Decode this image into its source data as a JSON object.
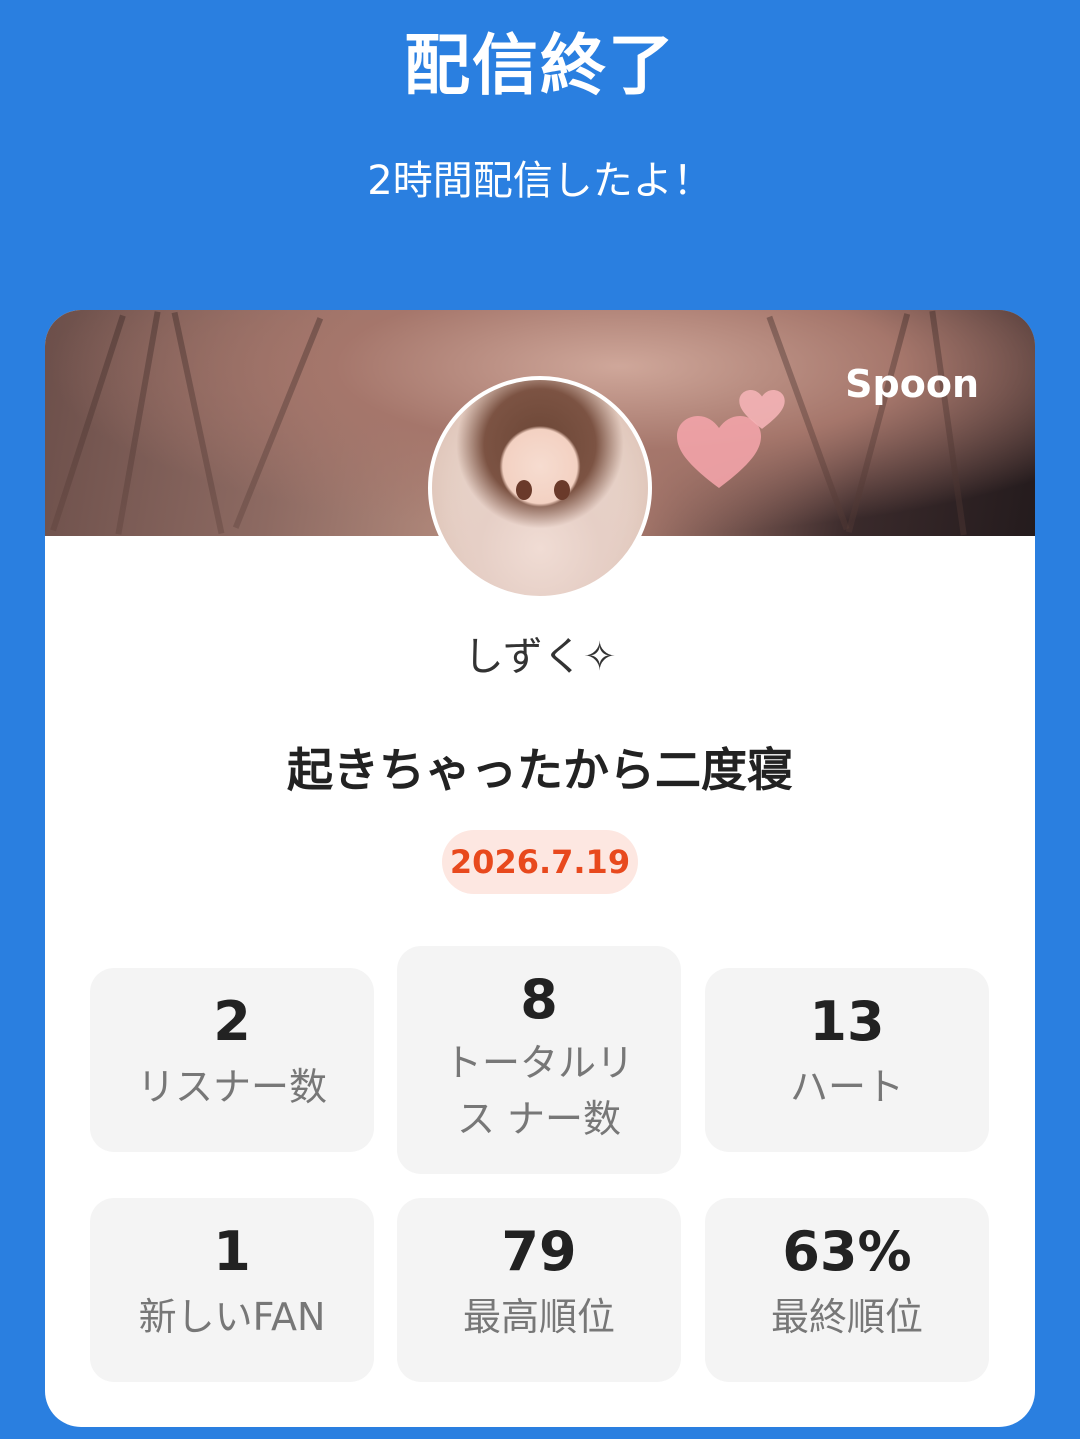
{
  "header": {
    "title": "配信終了",
    "subtitle": "2時間配信したよ！"
  },
  "card": {
    "logo": "Spoon",
    "username": "しずく✧",
    "broadcast_title": "起きちゃったから二度寝",
    "date": "2026.7.19",
    "stats": [
      {
        "value": "2",
        "label": "リスナー数"
      },
      {
        "value": "8",
        "label": "トータルリス ナー数"
      },
      {
        "value": "13",
        "label": "ハート"
      },
      {
        "value": "1",
        "label": "新しいFAN"
      },
      {
        "value": "79",
        "label": "最高順位"
      },
      {
        "value": "63%",
        "label": "最終順位"
      }
    ]
  },
  "colors": {
    "background": "#2a7fe0",
    "date_text": "#e8491d",
    "date_pill": "#fde7e1"
  }
}
